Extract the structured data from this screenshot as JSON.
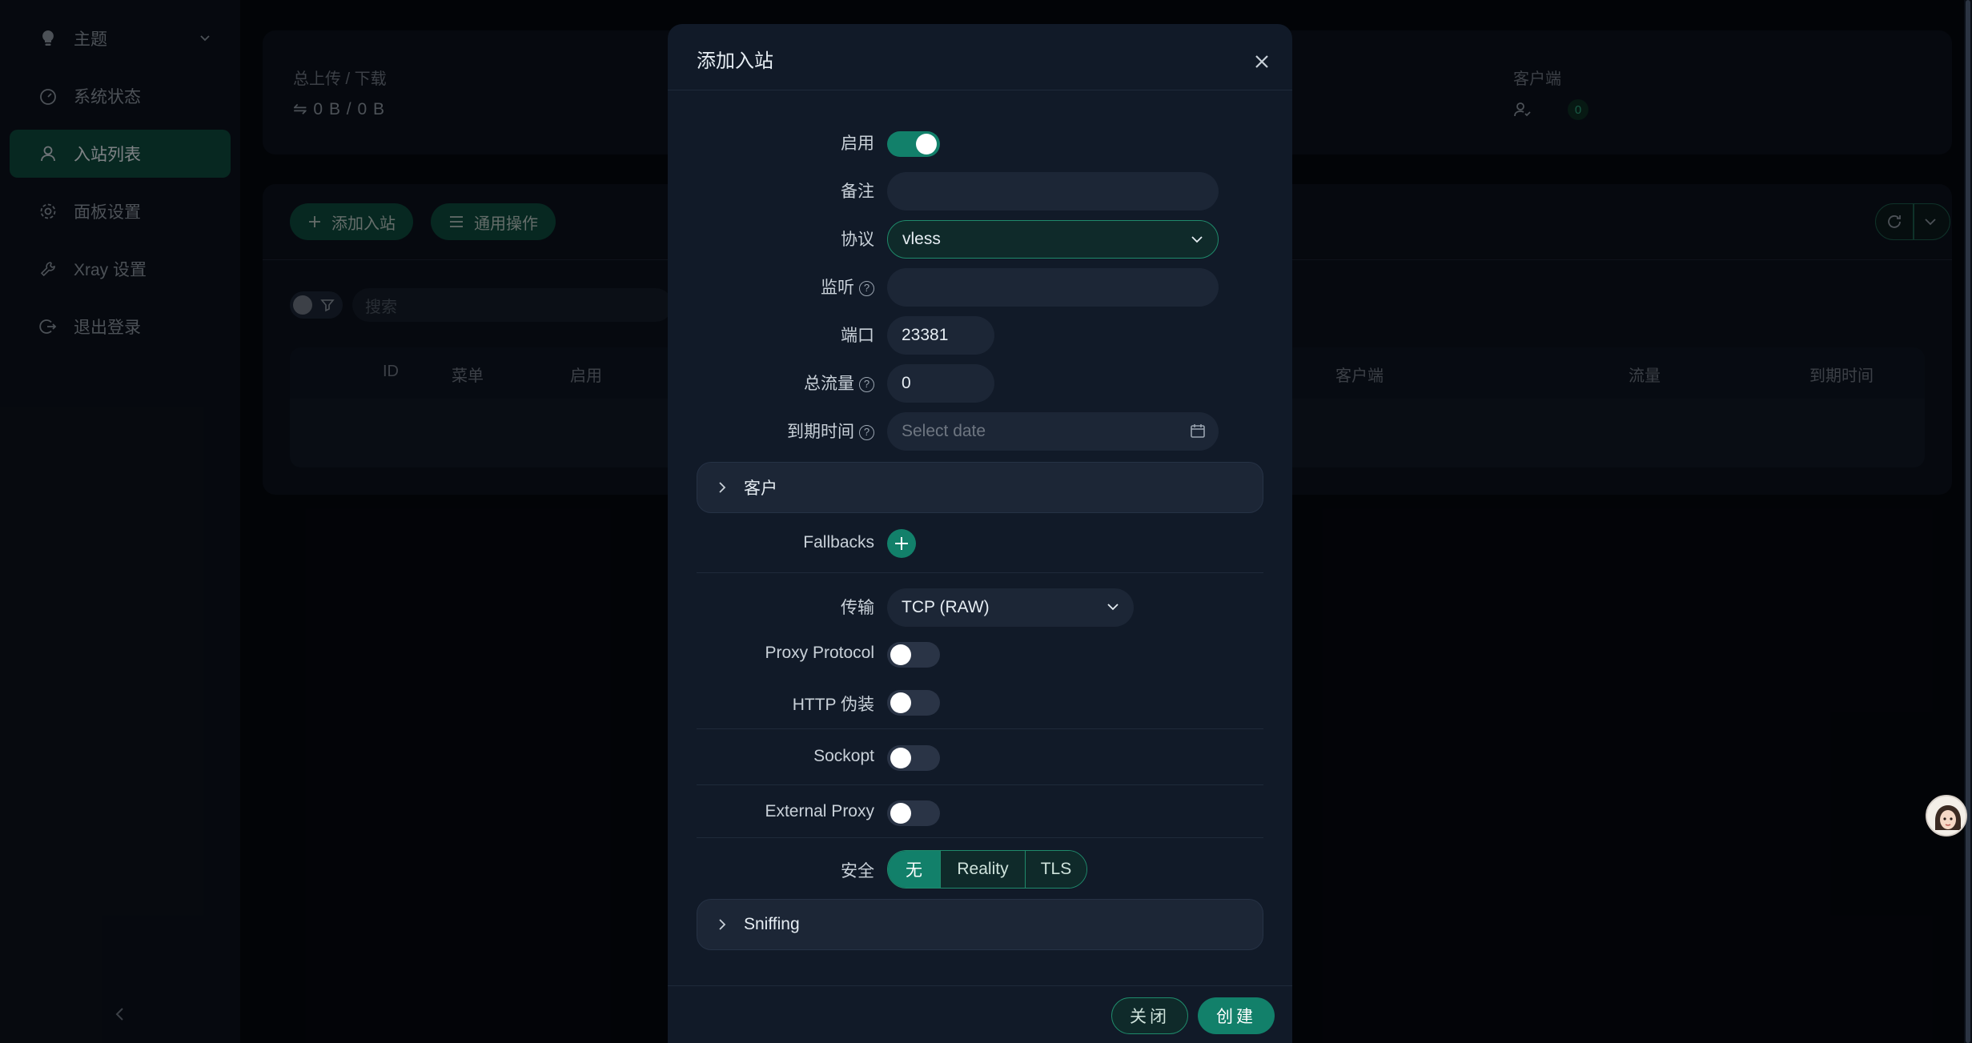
{
  "sidebar": {
    "items": [
      {
        "label": "主题",
        "icon": "bulb-icon"
      },
      {
        "label": "系统状态",
        "icon": "dashboard-icon"
      },
      {
        "label": "入站列表",
        "icon": "user-icon"
      },
      {
        "label": "面板设置",
        "icon": "gear-icon"
      },
      {
        "label": "Xray 设置",
        "icon": "tool-icon"
      },
      {
        "label": "退出登录",
        "icon": "logout-icon"
      }
    ]
  },
  "stats": {
    "upload_label": "总上传 / 下载",
    "upload_value": "⇋ 0 B / 0 B",
    "clients_label": "客户端",
    "clients_count": "0"
  },
  "toolbar": {
    "add_label": "添加入站",
    "general_label": "通用操作",
    "search_placeholder": "搜索"
  },
  "table": {
    "headers": [
      "ID",
      "菜单",
      "启用",
      "客户端",
      "流量",
      "到期时间"
    ]
  },
  "modal": {
    "title": "添加入站",
    "fields": {
      "enable_label": "启用",
      "remark_label": "备注",
      "remark_value": "",
      "protocol_label": "协议",
      "protocol_value": "vless",
      "listen_label": "监听",
      "listen_value": "",
      "port_label": "端口",
      "port_value": "23381",
      "total_label": "总流量",
      "total_value": "0",
      "expiry_label": "到期时间",
      "expiry_placeholder": "Select date",
      "clients_panel": "客户",
      "fallbacks_label": "Fallbacks",
      "transport_label": "传输",
      "transport_value": "TCP (RAW)",
      "proxy_protocol_label": "Proxy Protocol",
      "http_label": "HTTP 伪装",
      "sockopt_label": "Sockopt",
      "external_proxy_label": "External Proxy",
      "security_label": "安全",
      "security_options": [
        "无",
        "Reality",
        "TLS"
      ],
      "security_selected": "无",
      "sniffing_panel": "Sniffing"
    },
    "footer": {
      "close_label": "关闭",
      "create_label": "创建"
    }
  },
  "colors": {
    "accent": "#12806a",
    "accent_dark": "#0d4a3d",
    "bg": "#06090f",
    "modal_bg": "#111a28"
  }
}
